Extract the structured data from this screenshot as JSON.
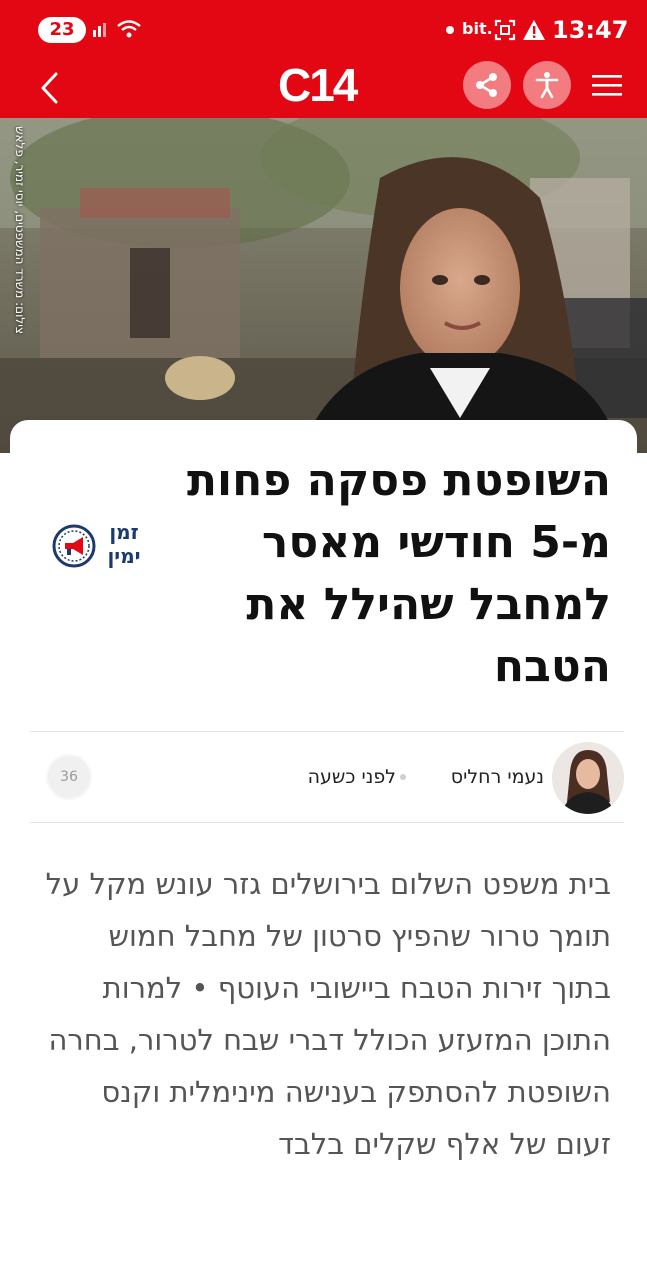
{
  "status_bar": {
    "notification_count": "23",
    "carrier_tag": "bit.",
    "time": "13:47"
  },
  "header": {
    "logo": "C14",
    "icons": [
      "back-chevron-icon",
      "share-icon",
      "accessibility-icon",
      "hamburger-menu-icon"
    ]
  },
  "hero": {
    "photo_credit": "צילום: משרד המשפטים, יוסי זמיר, פלאש"
  },
  "article": {
    "headline": "השופטת פסקה פחות מ-5 חודשי מאסר למחבל שהילל את הטבח",
    "section_badge": {
      "line1": "זמן",
      "line2": "ימין"
    },
    "author": "נעמי רחליס",
    "published": "לפני כשעה",
    "comments_count": "36",
    "lead": "בית משפט השלום בירושלים גזר עונש מקל על תומך טרור שהפיץ סרטון של מחבל חמוש בתוך זירות הטבח ביישובי העוטף • למרות התוכן המזעזע הכולל דברי שבח לטרור, בחרה השופטת להסתפק בענישה מינימלית וקנס זעום של אלף שקלים בלבד"
  },
  "colors": {
    "brand_red": "#e30613",
    "badge_blue": "#1d3a6e",
    "button_pink": "#f37c81"
  }
}
